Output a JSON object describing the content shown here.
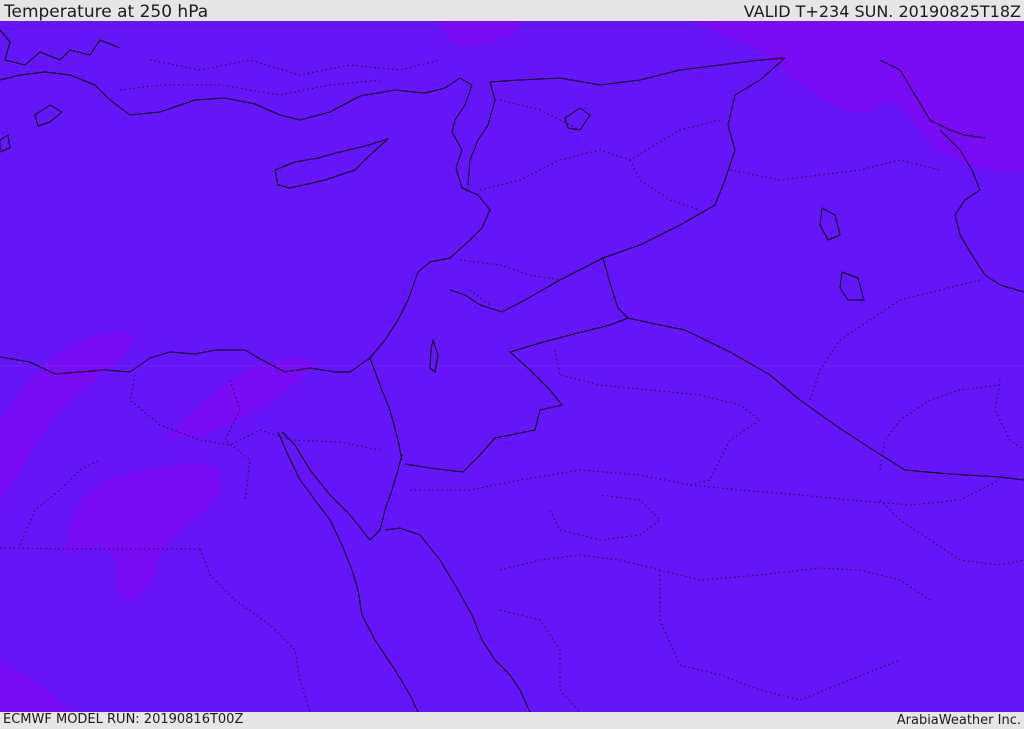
{
  "header": {
    "title": "Temperature at 250 hPa",
    "valid": "VALID T+234 SUN. 20190825T18Z"
  },
  "footer": {
    "model_run": "ECMWF MODEL RUN: 20190816T00Z",
    "credit": "ArabiaWeather Inc."
  },
  "map": {
    "base_color": "#6515f7",
    "warm_patch_color": "#7a0cf5",
    "line_color": "#000000"
  }
}
